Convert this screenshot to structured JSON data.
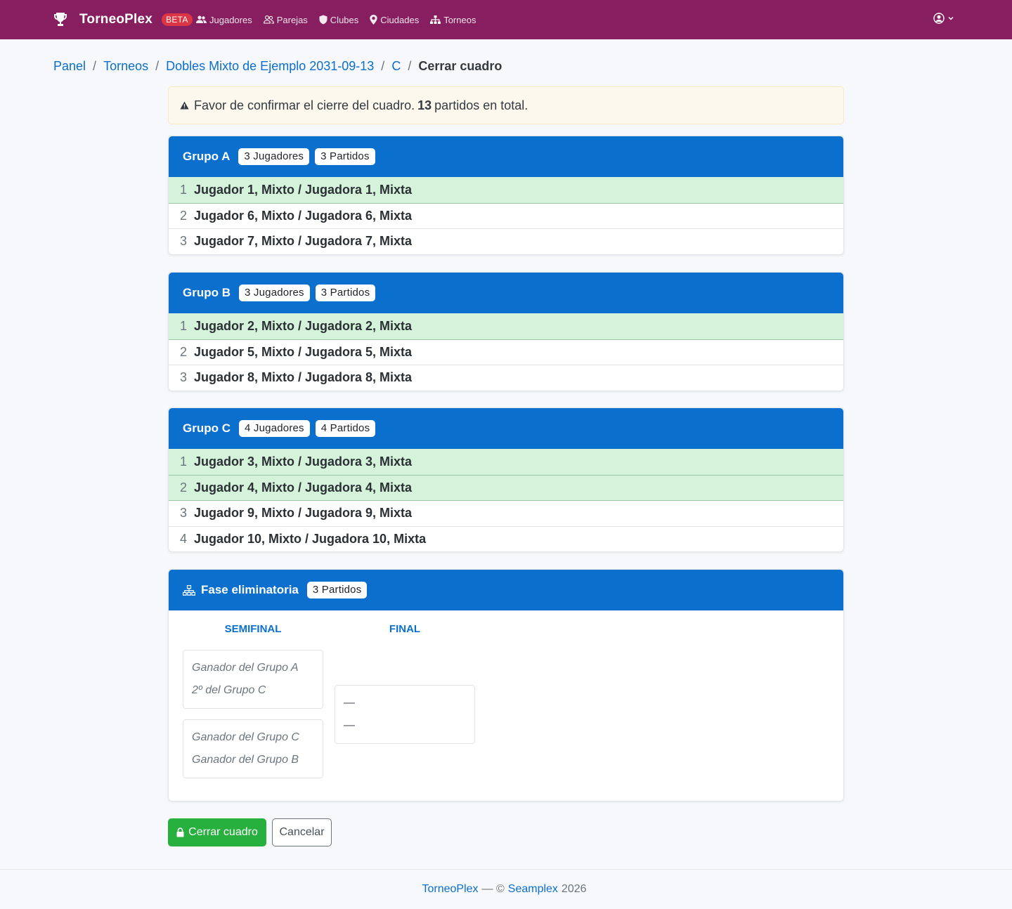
{
  "app": {
    "name": "TorneoPlex",
    "badge": "BETA"
  },
  "nav": [
    {
      "label": "Jugadores",
      "icon": "users-icon"
    },
    {
      "label": "Parejas",
      "icon": "pair-icon"
    },
    {
      "label": "Clubes",
      "icon": "shield-icon"
    },
    {
      "label": "Ciudades",
      "icon": "map-pin-icon"
    },
    {
      "label": "Torneos",
      "icon": "sitemap-icon"
    }
  ],
  "breadcrumb": {
    "items": [
      "Panel",
      "Torneos",
      "Dobles Mixto de Ejemplo 2031-09-13",
      "C"
    ],
    "current": "Cerrar cuadro",
    "separator": "/"
  },
  "alert": {
    "text_before": "Favor de confirmar el cierre del cuadro.",
    "count": "13",
    "text_after": "partidos en total."
  },
  "groups": [
    {
      "title": "Grupo A",
      "players_badge": "3 Jugadores",
      "matches_badge": "3 Partidos",
      "rows": [
        {
          "pos": "1",
          "team": "Jugador 1, Mixto / Jugadora 1, Mixta",
          "qualified": true
        },
        {
          "pos": "2",
          "team": "Jugador 6, Mixto / Jugadora 6, Mixta",
          "qualified": false
        },
        {
          "pos": "3",
          "team": "Jugador 7, Mixto / Jugadora 7, Mixta",
          "qualified": false
        }
      ]
    },
    {
      "title": "Grupo B",
      "players_badge": "3 Jugadores",
      "matches_badge": "3 Partidos",
      "rows": [
        {
          "pos": "1",
          "team": "Jugador 2, Mixto / Jugadora 2, Mixta",
          "qualified": true
        },
        {
          "pos": "2",
          "team": "Jugador 5, Mixto / Jugadora 5, Mixta",
          "qualified": false
        },
        {
          "pos": "3",
          "team": "Jugador 8, Mixto / Jugadora 8, Mixta",
          "qualified": false
        }
      ]
    },
    {
      "title": "Grupo C",
      "players_badge": "4 Jugadores",
      "matches_badge": "4 Partidos",
      "rows": [
        {
          "pos": "1",
          "team": "Jugador 3, Mixto / Jugadora 3, Mixta",
          "qualified": true
        },
        {
          "pos": "2",
          "team": "Jugador 4, Mixto / Jugadora 4, Mixta",
          "qualified": true
        },
        {
          "pos": "3",
          "team": "Jugador 9, Mixto / Jugadora 9, Mixta",
          "qualified": false
        },
        {
          "pos": "4",
          "team": "Jugador 10, Mixto / Jugadora 10, Mixta",
          "qualified": false
        }
      ]
    }
  ],
  "knockout": {
    "title": "Fase eliminatoria",
    "matches_badge": "3 Partidos",
    "rounds": [
      {
        "label": "SEMIFINAL",
        "matches": [
          [
            "Ganador del Grupo A",
            "2º del Grupo C"
          ],
          [
            "Ganador del Grupo C",
            "Ganador del Grupo B"
          ]
        ]
      },
      {
        "label": "FINAL",
        "matches": [
          [
            "—",
            "—"
          ]
        ]
      }
    ]
  },
  "buttons": {
    "close": "Cerrar cuadro",
    "cancel": "Cancelar"
  },
  "footer": {
    "app": "TorneoPlex",
    "middle": "— ©",
    "company": "Seamplex",
    "year": "2026"
  },
  "colors": {
    "navbar": "#861e5f",
    "primary": "#0a6fcd",
    "success": "#28b03f",
    "qualified_row": "#d5f2da",
    "badge": "#dc3545"
  }
}
